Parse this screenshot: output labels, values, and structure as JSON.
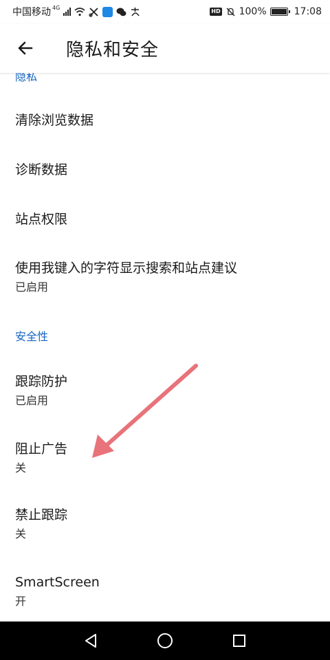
{
  "status_bar": {
    "carrier": "中国移动",
    "network": "4G",
    "battery_percent": "100%",
    "time": "17:08",
    "hd_badge": "HD"
  },
  "app_bar": {
    "title": "隐私和安全",
    "back_icon": "arrow-left-icon"
  },
  "sections": {
    "privacy_header": "隐私",
    "security_header": "安全性"
  },
  "items": {
    "clear_browsing": {
      "title": "清除浏览数据"
    },
    "diagnostics": {
      "title": "诊断数据"
    },
    "site_permissions": {
      "title": "站点权限"
    },
    "suggestions": {
      "title": "使用我键入的字符显示搜索和站点建议",
      "subtitle": "已启用"
    },
    "tracking_prevention": {
      "title": "跟踪防护",
      "subtitle": "已启用"
    },
    "block_ads": {
      "title": "阻止广告",
      "subtitle": "关"
    },
    "do_not_track": {
      "title": "禁止跟踪",
      "subtitle": "关"
    },
    "smartscreen": {
      "title": "SmartScreen",
      "subtitle": "开"
    }
  },
  "colors": {
    "accent": "#1565c0",
    "annotation_arrow": "#e8737a"
  },
  "nav_bar": {
    "back": "triangle-back-icon",
    "home": "circle-home-icon",
    "recents": "square-recents-icon"
  }
}
